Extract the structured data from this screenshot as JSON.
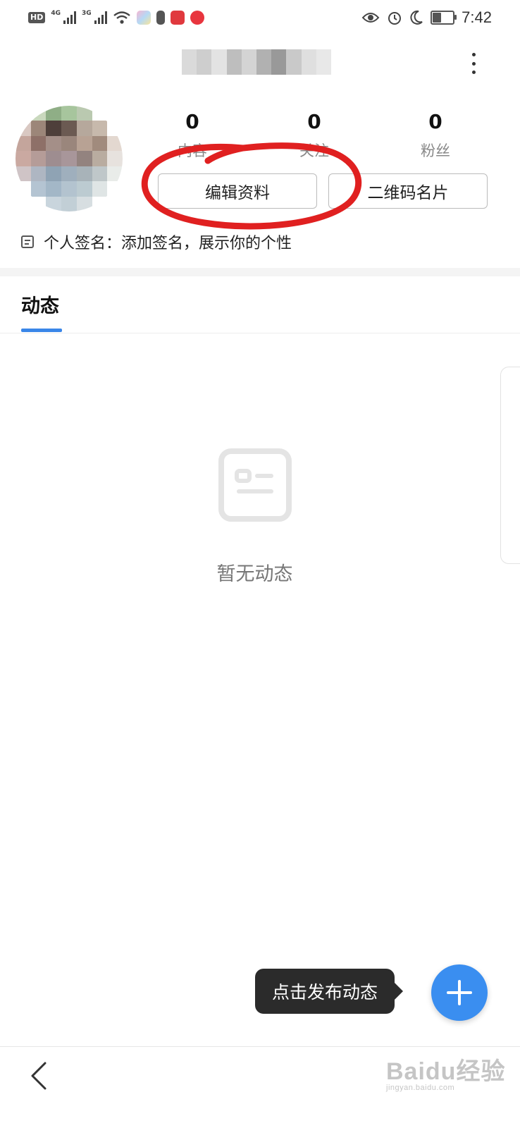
{
  "status_bar": {
    "hd_label": "HD",
    "net1_label": "4G",
    "net2_label": "3G",
    "time": "7:42",
    "battery_level_fraction": 0.4
  },
  "profile": {
    "stats": [
      {
        "value": "0",
        "label": "内容"
      },
      {
        "value": "0",
        "label": "关注"
      },
      {
        "value": "0",
        "label": "粉丝"
      }
    ],
    "edit_button_label": "编辑资料",
    "qr_button_label": "二维码名片",
    "signature_prefix": "个人签名",
    "signature_text": "添加签名，展示你的个性"
  },
  "tabs": [
    {
      "label": "动态",
      "active": true
    }
  ],
  "empty_state": {
    "text": "暂无动态"
  },
  "publish": {
    "tooltip": "点击发布动态"
  },
  "watermark": {
    "main": "Baidu经验",
    "sub": "jingyan.baidu.com"
  },
  "colors": {
    "accent": "#3a86e8",
    "fab": "#3a8ef0",
    "annotation": "#e02020",
    "tooltip_bg": "#2b2b2b"
  },
  "icons": {
    "more": "more-vertical-icon",
    "signature": "note-icon",
    "empty": "document-card-icon",
    "fab": "plus-icon",
    "back": "chevron-left-icon"
  }
}
